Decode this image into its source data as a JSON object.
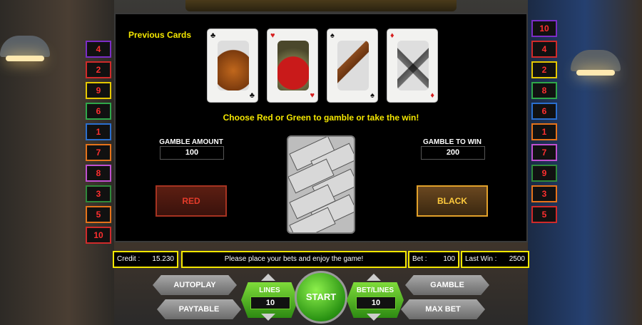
{
  "panel": {
    "previous_cards_label": "Previous Cards",
    "instruction": "Choose Red or Green to gamble or take the win!",
    "gamble_amount_label": "GAMBLE AMOUNT",
    "gamble_amount_value": "100",
    "gamble_to_win_label": "GAMBLE TO WIN",
    "gamble_to_win_value": "200",
    "red_label": "RED",
    "black_label": "BLACK",
    "previous_cards": [
      {
        "suit": "clubs",
        "symbol": "♣",
        "color": "#111111"
      },
      {
        "suit": "hearts",
        "symbol": "♥",
        "color": "#d62020"
      },
      {
        "suit": "spades",
        "symbol": "♠",
        "color": "#111111"
      },
      {
        "suit": "diamonds",
        "symbol": "♦",
        "color": "#d62020"
      }
    ]
  },
  "left_lines": [
    "4",
    "2",
    "9",
    "6",
    "1",
    "7",
    "8",
    "3",
    "5",
    "10"
  ],
  "right_lines": [
    "10",
    "4",
    "2",
    "8",
    "6",
    "1",
    "7",
    "9",
    "3",
    "5"
  ],
  "status": {
    "credit_label": "Credit :",
    "credit_value": "15.230",
    "message": "Please place your bets and enjoy the game!",
    "bet_label": "Bet :",
    "bet_value": "100",
    "last_win_label": "Last Win :",
    "last_win_value": "2500"
  },
  "controls": {
    "autoplay": "AUTOPLAY",
    "paytable": "PAYTABLE",
    "lines_label": "LINES",
    "lines_value": "10",
    "start": "START",
    "bet_lines_label": "BET/LINES",
    "bet_lines_value": "10",
    "gamble": "GAMBLE",
    "max_bet": "MAX BET"
  },
  "colors": {
    "accent_yellow": "#f4e700",
    "red_button": "#e43b2a",
    "black_button_text": "#ffcb3d",
    "start_green": "#2a9313"
  }
}
